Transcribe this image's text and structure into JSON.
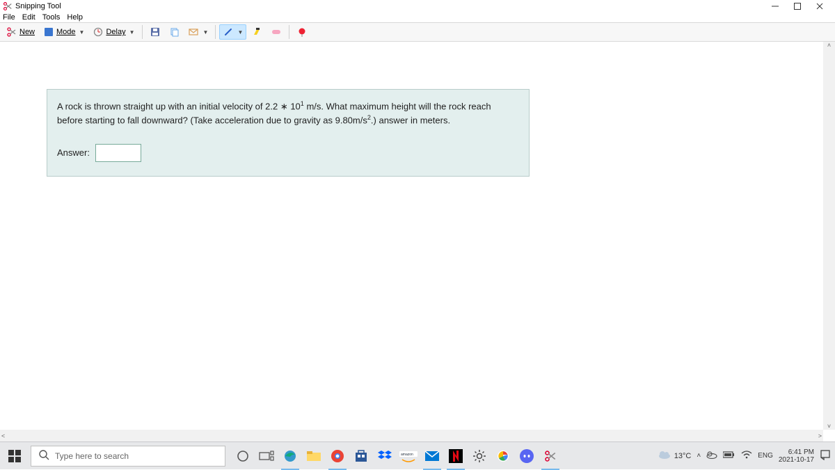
{
  "titlebar": {
    "app_title": "Snipping Tool"
  },
  "menu": {
    "file": "File",
    "edit": "Edit",
    "tools": "Tools",
    "help": "Help"
  },
  "toolbar": {
    "new_label": "New",
    "mode_label": "Mode",
    "delay_label": "Delay"
  },
  "question": {
    "text_part1": "A rock is thrown straight up with an initial velocity of ",
    "value1": "2.2 ∗ 10",
    "exp1": "1",
    "text_part2": " m/s. What maximum height will the rock reach before starting to fall downward? (Take acceleration due to gravity as ",
    "value2": "9.80m/s",
    "exp2": "2",
    "text_part3": ".) answer in meters.",
    "answer_label": "Answer:"
  },
  "taskbar": {
    "search_placeholder": "Type here to search",
    "weather_temp": "13°C",
    "lang": "ENG",
    "time": "6:41 PM",
    "date": "2021-10-17"
  }
}
